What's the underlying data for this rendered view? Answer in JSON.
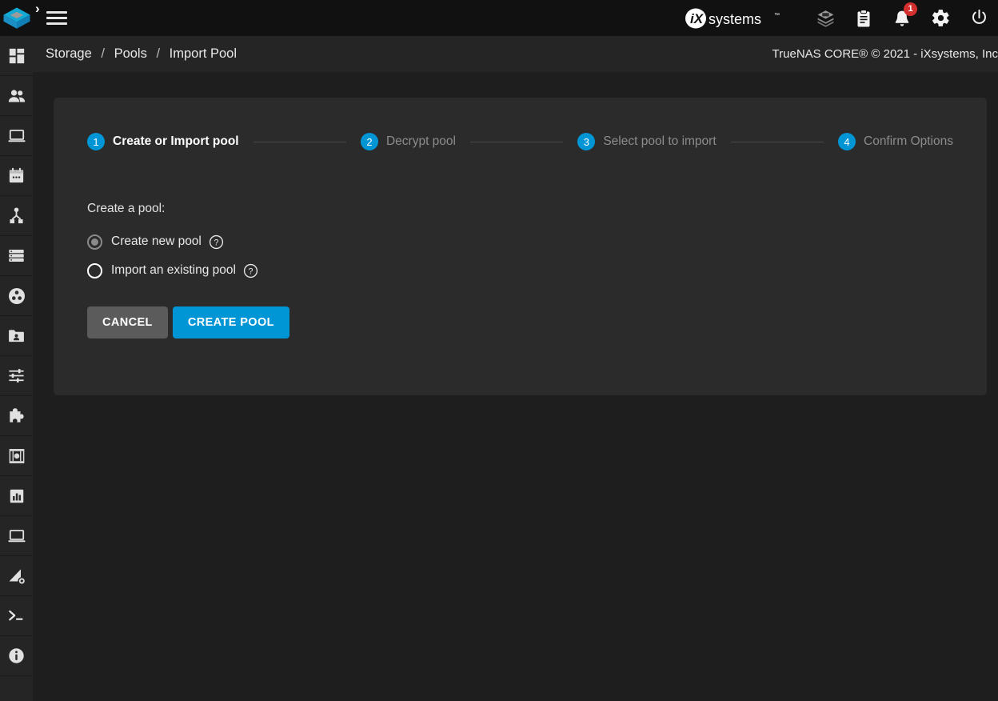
{
  "app": {
    "logo_name": "truenas-logo",
    "accent_color": "#0095d5",
    "badge_color": "#d32f2f",
    "page_bg": "#1e1e1e",
    "card_bg": "#2b2b2b",
    "topbar_bg": "#111111",
    "sidebar_bg": "#252525"
  },
  "topbar": {
    "menu_label": "menu-icon",
    "forward_chevron": "›",
    "brand_text": "iXsystems",
    "brand_tm": "™",
    "icons": [
      {
        "name": "layers-icon",
        "title": "iX Hardware"
      },
      {
        "name": "clipboard-icon",
        "title": "Task Manager"
      },
      {
        "name": "bell-icon",
        "title": "Alerts",
        "badge": "1"
      },
      {
        "name": "gear-icon",
        "title": "Settings"
      },
      {
        "name": "power-icon",
        "title": "Power"
      }
    ]
  },
  "sidebar": {
    "items": [
      {
        "name": "sidebar-item-dashboard",
        "icon": "dashboard-icon",
        "label": "Dashboard"
      },
      {
        "name": "sidebar-item-accounts",
        "icon": "accounts-people-icon",
        "label": "Accounts"
      },
      {
        "name": "sidebar-item-system",
        "icon": "system-laptop-icon",
        "label": "System"
      },
      {
        "name": "sidebar-item-tasks",
        "icon": "tasks-calendar-icon",
        "label": "Tasks"
      },
      {
        "name": "sidebar-item-network",
        "icon": "network-share-icon",
        "label": "Network"
      },
      {
        "name": "sidebar-item-storage",
        "icon": "storage-server-icon",
        "label": "Storage"
      },
      {
        "name": "sidebar-item-directory-services",
        "icon": "directory-services-icon",
        "label": "Directory Services"
      },
      {
        "name": "sidebar-item-sharing",
        "icon": "sharing-folder-icon",
        "label": "Sharing"
      },
      {
        "name": "sidebar-item-services",
        "icon": "services-sliders-icon",
        "label": "Services"
      },
      {
        "name": "sidebar-item-plugins",
        "icon": "plugins-puzzle-icon",
        "label": "Plugins"
      },
      {
        "name": "sidebar-item-jails",
        "icon": "jails-cage-icon",
        "label": "Jails"
      },
      {
        "name": "sidebar-item-reporting",
        "icon": "reporting-chart-icon",
        "label": "Reporting"
      },
      {
        "name": "sidebar-item-virtual-machines",
        "icon": "virtual-machines-icon",
        "label": "Virtual Machines"
      },
      {
        "name": "sidebar-item-apps",
        "icon": "apps-gear-icon",
        "label": "Apps"
      },
      {
        "name": "sidebar-item-shell",
        "icon": "shell-terminal-icon",
        "label": "Shell"
      },
      {
        "name": "sidebar-item-guide",
        "icon": "guide-info-icon",
        "label": "Guide"
      }
    ]
  },
  "breadcrumb": {
    "items": [
      "Storage",
      "Pools",
      "Import Pool"
    ],
    "separator": "/"
  },
  "header": {
    "copyright": "TrueNAS CORE® © 2021 - iXsystems, Inc"
  },
  "wizard": {
    "steps": [
      {
        "number": "1",
        "label": "Create or Import pool",
        "active": true
      },
      {
        "number": "2",
        "label": "Decrypt pool",
        "active": false
      },
      {
        "number": "3",
        "label": "Select pool to import",
        "active": false
      },
      {
        "number": "4",
        "label": "Confirm Options",
        "active": false
      }
    ]
  },
  "form": {
    "group_label": "Create a pool:",
    "options": [
      {
        "label": "Create new pool",
        "selected": true,
        "help": "help-icon"
      },
      {
        "label": "Import an existing pool",
        "selected": false,
        "help": "help-icon"
      }
    ]
  },
  "actions": {
    "cancel_label": "CANCEL",
    "create_label": "CREATE POOL"
  }
}
